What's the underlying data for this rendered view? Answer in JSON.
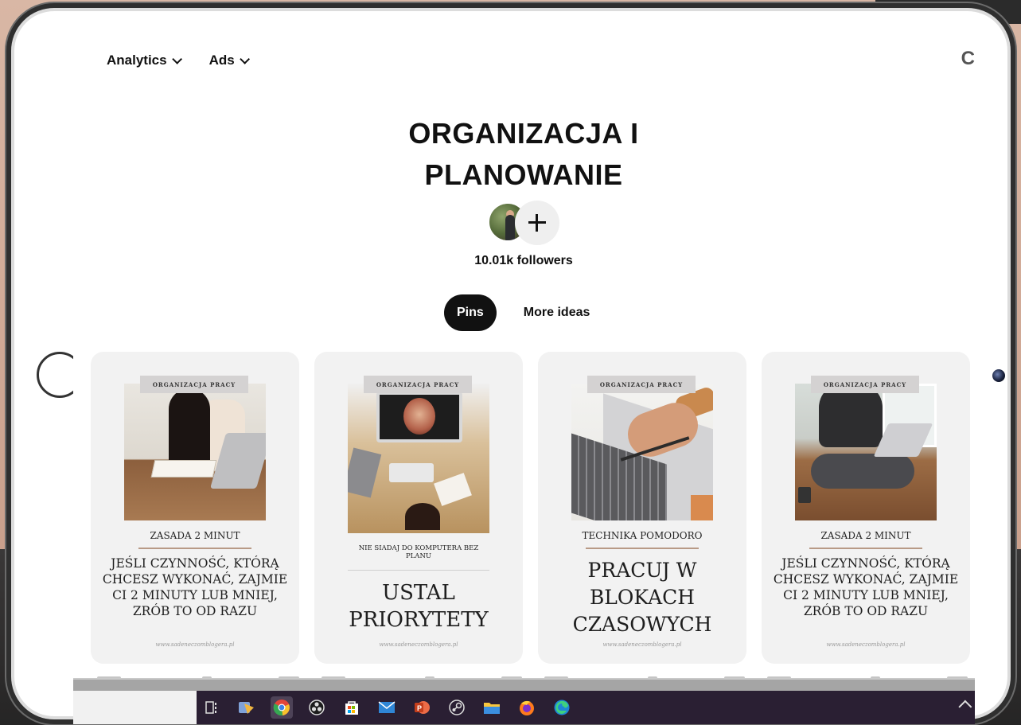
{
  "topnav": {
    "items": [
      {
        "label": "Analytics"
      },
      {
        "label": "Ads"
      }
    ],
    "corner_glyph": "C"
  },
  "board": {
    "title_line1": "ORGANIZACJA I",
    "title_line2": "PLANOWANIE",
    "followers": "10.01k followers",
    "add_icon": "plus-icon"
  },
  "tabs": [
    {
      "label": "Pins",
      "active": true
    },
    {
      "label": "More ideas",
      "active": false
    }
  ],
  "pins": [
    {
      "tag": "ORGANIZACJA PRACY",
      "subtitle": "ZASADA 2 MINUT",
      "main": "JEŚLI CZYNNOŚĆ, KTÓRĄ CHCESZ WYKONAĆ, ZAJMIE CI 2 MINUTY LUB MNIEJ, ZRÓB TO OD RAZU",
      "url": "www.sadeneczomblogera.pl"
    },
    {
      "tag": "ORGANIZACJA PRACY",
      "subtitle": "NIE SIADAJ DO KOMPUTERA BEZ PLANU",
      "main": "USTAL PRIORYTETY",
      "url": "www.sadeneczomblogera.pl"
    },
    {
      "tag": "ORGANIZACJA PRACY",
      "subtitle": "TECHNIKA POMODORO",
      "main": "PRACUJ W BLOKACH CZASOWYCH",
      "url": "www.sadeneczomblogera.pl"
    },
    {
      "tag": "ORGANIZACJA PRACY",
      "subtitle": "ZASADA 2 MINUT",
      "main": "JEŚLI CZYNNOŚĆ, KTÓRĄ CHCESZ WYKONAĆ, ZAJMIE CI 2 MINUTY LUB MNIEJ, ZRÓB TO OD RAZU",
      "url": "www.sadeneczomblogera.pl"
    }
  ],
  "taskbar": {
    "icons": [
      "task-view-icon",
      "photos-app-icon",
      "chrome-icon",
      "obs-icon",
      "store-icon",
      "mail-icon",
      "powerpoint-icon",
      "steam-icon",
      "file-explorer-icon",
      "firefox-icon",
      "edge-icon"
    ],
    "active_icon": "chrome-icon"
  },
  "colors": {
    "text": "#111111",
    "active_tab_bg": "#111111",
    "pin_bg": "#f2f2f2",
    "taskbar_bg": "#2a1f33",
    "accent_rule": "#b89a86"
  }
}
